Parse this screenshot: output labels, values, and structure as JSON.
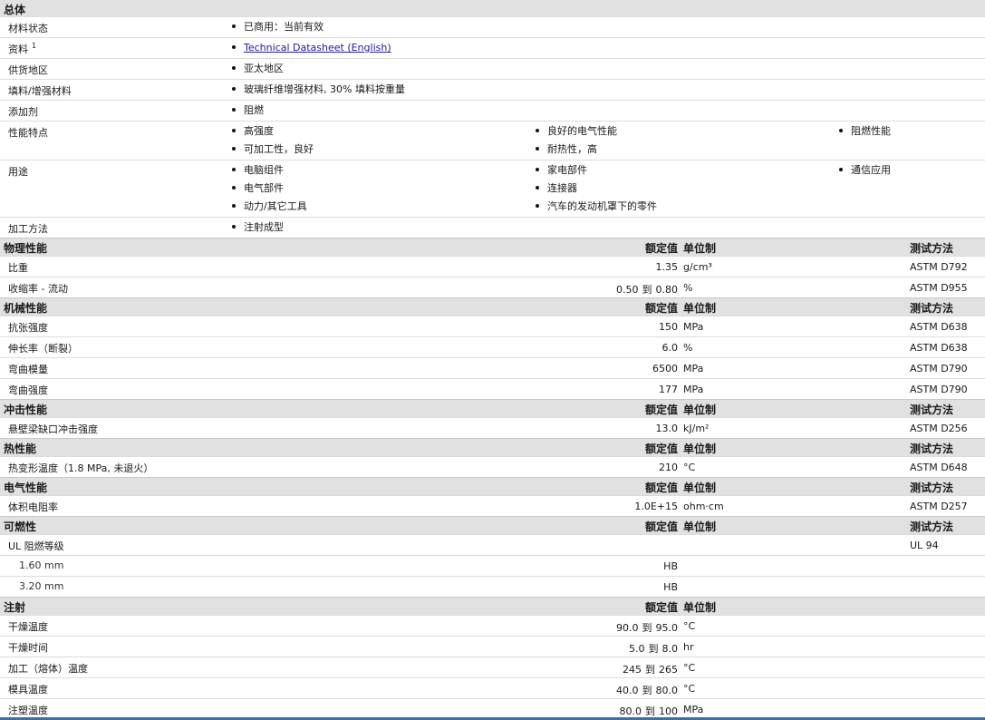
{
  "general": {
    "title": "总体",
    "rows": [
      {
        "label": "材料状态",
        "items": [
          "已商用：当前有效"
        ]
      },
      {
        "label": "资料",
        "sup": "1",
        "link": "Technical Datasheet (English)"
      },
      {
        "label": "供货地区",
        "items": [
          "亚太地区"
        ]
      },
      {
        "label": "填料/增强材料",
        "items": [
          "玻璃纤维增强材料, 30% 填料按重量"
        ]
      },
      {
        "label": "添加剂",
        "items": [
          "阻燃"
        ]
      },
      {
        "label": "性能特点",
        "cols": [
          [
            "高强度",
            "可加工性，良好"
          ],
          [
            "良好的电气性能",
            "耐热性，高"
          ],
          [
            "阻燃性能"
          ]
        ]
      },
      {
        "label": "用途",
        "cols": [
          [
            "电脑组件",
            "电气部件",
            "动力/其它工具"
          ],
          [
            "家电部件",
            "连接器",
            "汽车的发动机罩下的零件"
          ],
          [
            "通信应用"
          ]
        ]
      },
      {
        "label": "加工方法",
        "items": [
          "注射成型"
        ]
      }
    ]
  },
  "headers": {
    "nominal": "额定值",
    "unit": "单位制",
    "method": "测试方法"
  },
  "sections": [
    {
      "title": "物理性能",
      "show_method": true,
      "rows": [
        {
          "label": "比重",
          "value": "1.35",
          "unit": "g/cm³",
          "method": "ASTM D792"
        },
        {
          "label": "收缩率 - 流动",
          "value": "0.50",
          "to": "到",
          "value2": "0.80",
          "unit": "%",
          "method": "ASTM D955"
        }
      ]
    },
    {
      "title": "机械性能",
      "show_method": true,
      "rows": [
        {
          "label": "抗张强度",
          "value": "150",
          "unit": "MPa",
          "method": "ASTM D638"
        },
        {
          "label": "伸长率（断裂）",
          "value": "6.0",
          "unit": "%",
          "method": "ASTM D638"
        },
        {
          "label": "弯曲模量",
          "value": "6500",
          "unit": "MPa",
          "method": "ASTM D790"
        },
        {
          "label": "弯曲强度",
          "value": "177",
          "unit": "MPa",
          "method": "ASTM D790"
        }
      ]
    },
    {
      "title": "冲击性能",
      "show_method": true,
      "rows": [
        {
          "label": "悬壁梁缺口冲击强度",
          "value": "13.0",
          "unit": "kJ/m²",
          "method": "ASTM D256"
        }
      ]
    },
    {
      "title": "热性能",
      "show_method": true,
      "rows": [
        {
          "label": "热变形温度（1.8 MPa, 未退火）",
          "value": "210",
          "unit": "°C",
          "method": "ASTM D648"
        }
      ]
    },
    {
      "title": "电气性能",
      "show_method": true,
      "rows": [
        {
          "label": "体积电阻率",
          "value": "1.0E+15",
          "unit": "ohm·cm",
          "method": "ASTM D257"
        }
      ]
    },
    {
      "title": "可燃性",
      "show_method": true,
      "rows": [
        {
          "label": "UL 阻燃等级",
          "value": "",
          "unit": "",
          "method": "UL 94"
        },
        {
          "label": "1.60 mm",
          "indent": true,
          "value": "HB",
          "unit": "",
          "method": ""
        },
        {
          "label": "3.20 mm",
          "indent": true,
          "value": "HB",
          "unit": "",
          "method": ""
        }
      ]
    },
    {
      "title": "注射",
      "show_method": false,
      "rows": [
        {
          "label": "干燥温度",
          "value": "90.0",
          "to": "到",
          "value2": "95.0",
          "unit": "°C",
          "method": ""
        },
        {
          "label": "干燥时间",
          "value": "5.0",
          "to": "到",
          "value2": "8.0",
          "unit": "hr",
          "method": ""
        },
        {
          "label": "加工（熔体）温度",
          "value": "245",
          "to": "到",
          "value2": "265",
          "unit": "°C",
          "method": ""
        },
        {
          "label": "模具温度",
          "value": "40.0",
          "to": "到",
          "value2": "80.0",
          "unit": "°C",
          "method": ""
        },
        {
          "label": "注塑温度",
          "value": "80.0",
          "to": "到",
          "value2": "100",
          "unit": "MPa",
          "method": ""
        }
      ]
    }
  ]
}
